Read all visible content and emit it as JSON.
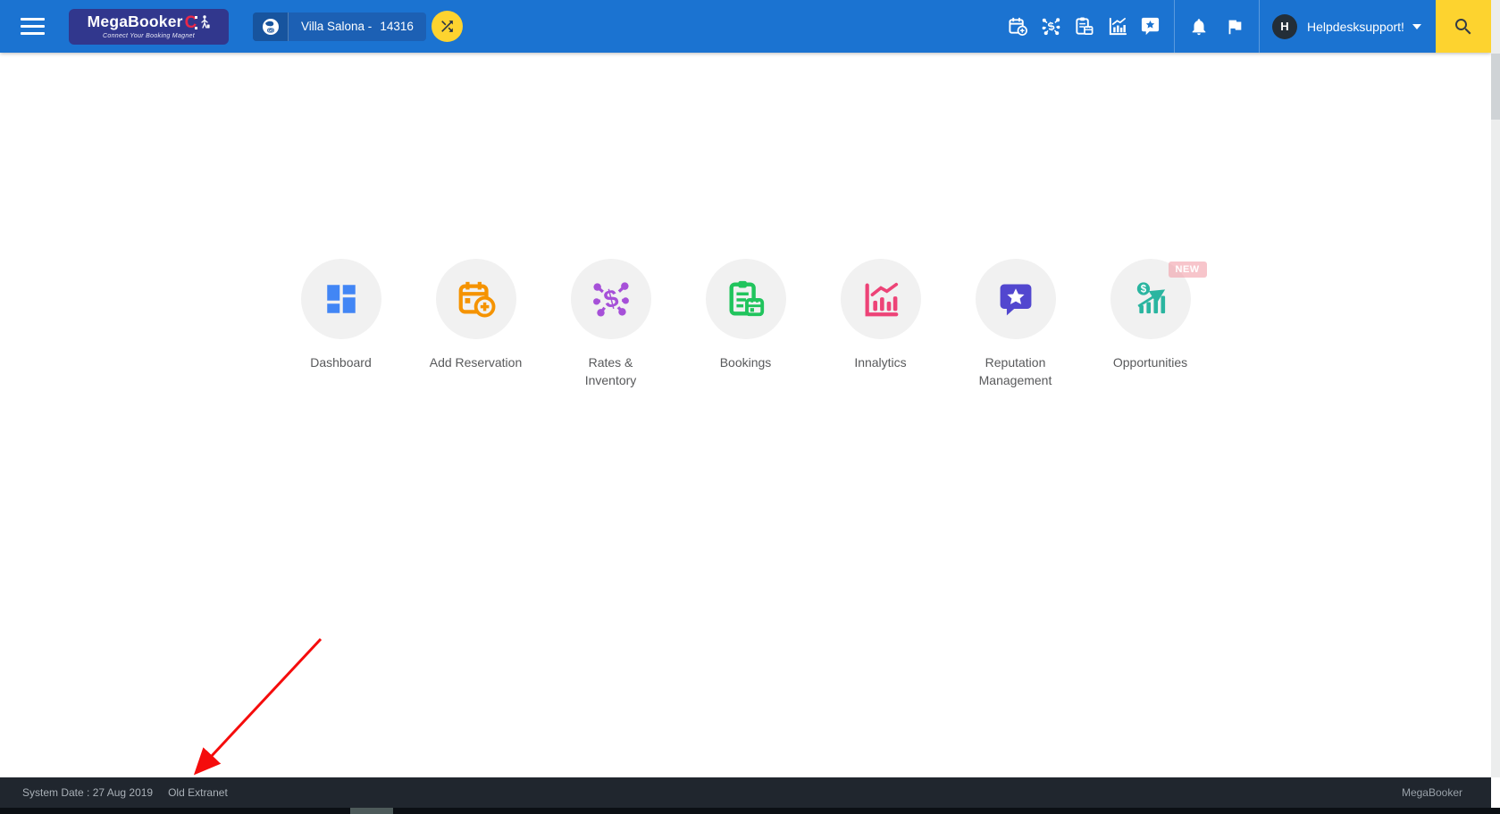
{
  "colors": {
    "header_bg": "#1b73d1",
    "logo_bg": "#31378d",
    "logo_accent": "#e8284a",
    "property_bg": "#1c60b4",
    "search_bg": "#fdd32f",
    "tile_circle_bg": "#f1f1f1",
    "dashboard": "#4286f5",
    "add_reservation": "#f59300",
    "rates_inventory": "#a650d8",
    "bookings": "#21c45d",
    "innalytics": "#ed4377",
    "reputation": "#5247cf",
    "opportunities": "#2ab5a0",
    "footer_bg": "#20262e",
    "annotation_arrow": "#f50c0c"
  },
  "header": {
    "brand": {
      "name": "MegaBooker",
      "accent_letter": "C",
      "tagline": "Connect Your Booking Magnet"
    },
    "property": {
      "name": "Villa Salona -",
      "code": "14316"
    },
    "icons": {
      "quick": [
        "calendar-plus",
        "rates-network",
        "clipboard-calendar",
        "analytics-chart",
        "star-bubble"
      ],
      "alerts": [
        "bell",
        "flag"
      ],
      "search": "magnifier"
    },
    "user": {
      "initial": "H",
      "name": "Helpdesksupport!"
    }
  },
  "tiles": [
    {
      "label": "Dashboard",
      "lines": [
        "Dashboard"
      ]
    },
    {
      "label": "Add Reservation",
      "lines": [
        "Add Reservation"
      ]
    },
    {
      "label": "Rates & Inventory",
      "lines": [
        "Rates &",
        "Inventory"
      ]
    },
    {
      "label": "Bookings",
      "lines": [
        "Bookings"
      ]
    },
    {
      "label": "Innalytics",
      "lines": [
        "Innalytics"
      ]
    },
    {
      "label": "Reputation Management",
      "lines": [
        "Reputation",
        "Management"
      ]
    },
    {
      "label": "Opportunities",
      "lines": [
        "Opportunities"
      ],
      "badge": "NEW"
    }
  ],
  "footer": {
    "system_date": "System Date : 27 Aug 2019",
    "old_extranet_label": "Old Extranet",
    "brand": "MegaBooker"
  }
}
